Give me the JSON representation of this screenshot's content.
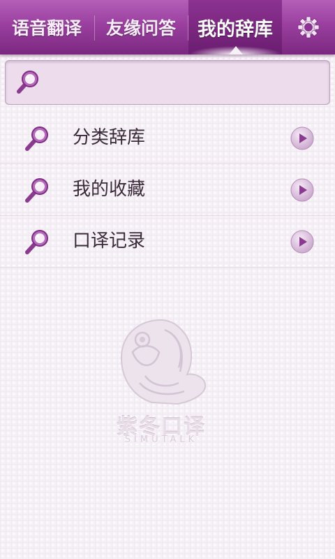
{
  "tabs": [
    {
      "label": "语音翻译",
      "active": false
    },
    {
      "label": "友缘问答",
      "active": false
    },
    {
      "label": "我的辞库",
      "active": true
    }
  ],
  "settings_icon": "gear-icon",
  "search": {
    "value": "",
    "placeholder": "",
    "icon": "magnifier-icon"
  },
  "list": {
    "items": [
      {
        "label": "分类辞库",
        "icon": "magnifier-icon",
        "action_icon": "play-arrow-icon"
      },
      {
        "label": "我的收藏",
        "icon": "magnifier-icon",
        "action_icon": "play-arrow-icon"
      },
      {
        "label": "口译记录",
        "icon": "magnifier-icon",
        "action_icon": "play-arrow-icon"
      }
    ]
  },
  "watermark": {
    "title_cn": "紫冬口译",
    "title_en": "SIMUTALK"
  },
  "colors": {
    "accent": "#9a3f9f",
    "accent_dark": "#6a1d70",
    "background": "#f6f1f6",
    "text": "#3a2a3a"
  }
}
